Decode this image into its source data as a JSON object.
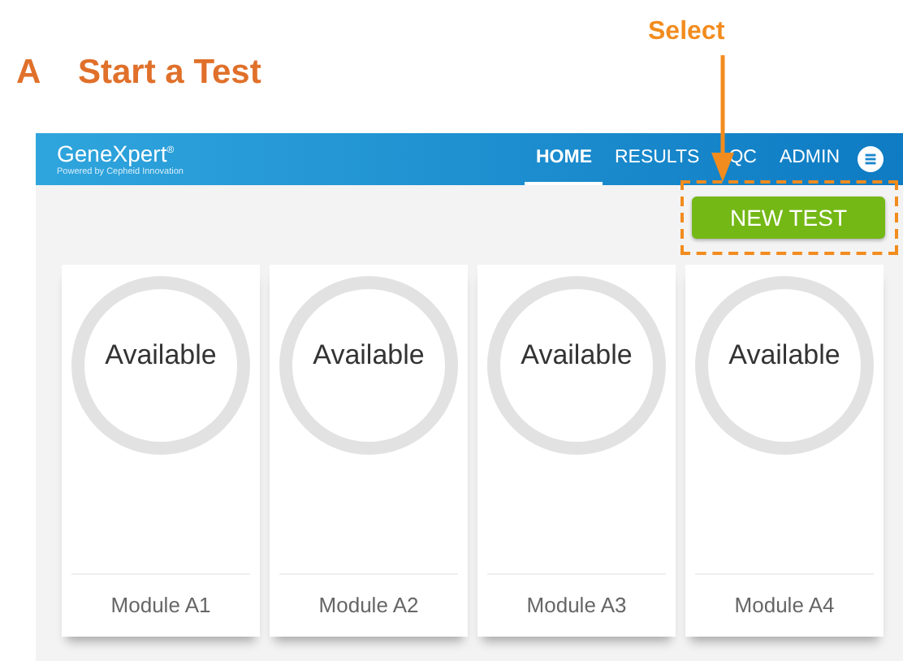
{
  "figure": {
    "panel_label": "A",
    "title": "Start a Test",
    "callout": "Select"
  },
  "app": {
    "logo": {
      "name": "GeneXpert$^{®}$",
      "tagline": "Powered by Cepheid Innovation"
    },
    "nav": [
      {
        "label": "HOME",
        "selected": true
      },
      {
        "label": "RESULTS",
        "selected": false
      },
      {
        "label": "QC",
        "selected": false
      },
      {
        "label": "ADMIN",
        "selected": false
      }
    ],
    "new_test_button": "NEW TEST",
    "modules": [
      {
        "status": "Available",
        "name": "Module A1"
      },
      {
        "status": "Available",
        "name": "Module A2"
      },
      {
        "status": "Available",
        "name": "Module A3"
      },
      {
        "status": "Available",
        "name": "Module A4"
      }
    ]
  }
}
